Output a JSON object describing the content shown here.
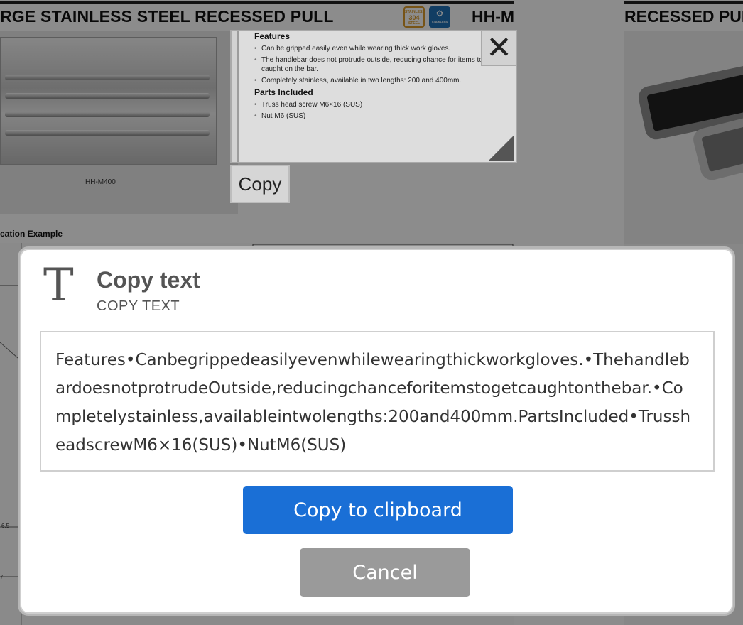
{
  "background": {
    "title": "RGE STAINLESS STEEL RECESSED PULL",
    "model": "HH-M",
    "badge_steel": "304",
    "badge_steel_top": "STAINLESS",
    "badge_steel_bottom": "STEEL",
    "badge_stainless": "STAINLESS",
    "right_title": "RECESSED PUL",
    "photo_caption": "HH-M400",
    "application_label": "cation Example",
    "dim_1": "6.5",
    "dim_2": "7"
  },
  "clip": {
    "features_heading": "Features",
    "features": [
      "Can be gripped easily even while wearing thick work gloves.",
      "The handlebar does not protrude outside, reducing chance for items to get caught on the bar.",
      "Completely stainless, available in two lengths: 200 and 400mm."
    ],
    "parts_heading": "Parts Included",
    "parts": [
      "Truss head screw M6×16 (SUS)",
      "Nut M6 (SUS)"
    ],
    "close_symbol": "✕",
    "copy_label": "Copy"
  },
  "dialog": {
    "icon_glyph": "T",
    "title": "Copy text",
    "subtitle": "COPY TEXT",
    "text": "Features•Canbegrippedeasilyevenwhilewearingthickworkgloves.•ThehandlebardoesnotprotrudeOutside,reducingchanceforitemstogetcaughtonthebar.•Completelystainless,availableintwolengths:200and400mm.PartsIncluded•TrussheadscrewM6×16(SUS)•NutM6(SUS)",
    "copy_button": "Copy to clipboard",
    "cancel_button": "Cancel"
  },
  "colors": {
    "primary": "#1a6fd6",
    "cancel": "#9a9a9a"
  }
}
